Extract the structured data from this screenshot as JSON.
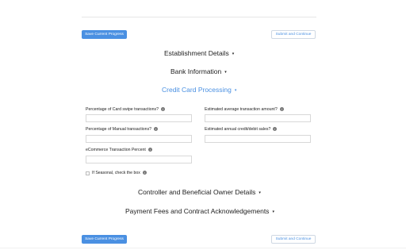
{
  "header": {
    "fragment": "_ _ _ _ _ _ _ _ _ _ _ _"
  },
  "buttons": {
    "save_progress": "Save Current Progress",
    "submit_continue": "Submit and Continue"
  },
  "sections": {
    "establishment": "Establishment Details",
    "bank": "Bank Information",
    "credit_card": "Credit Card Processing",
    "controller": "Controller and Beneficial Owner Details",
    "payment_fees": "Payment Fees and Contract Acknowledgements"
  },
  "form": {
    "card_swipe_label": "Percentage of Card swipe transactions?",
    "avg_transaction_label": "Estimated average transaction amount?",
    "manual_label": "Percentage of Manual transactions?",
    "annual_sales_label": "Estimated annual credit/debit sales?",
    "ecommerce_label": "eCommerce Transaction Percent",
    "seasonal_label": "If Seasonal, check the box"
  },
  "icons": {
    "caret": "▾",
    "info": "i"
  },
  "colors": {
    "accent": "#4a90e2"
  }
}
